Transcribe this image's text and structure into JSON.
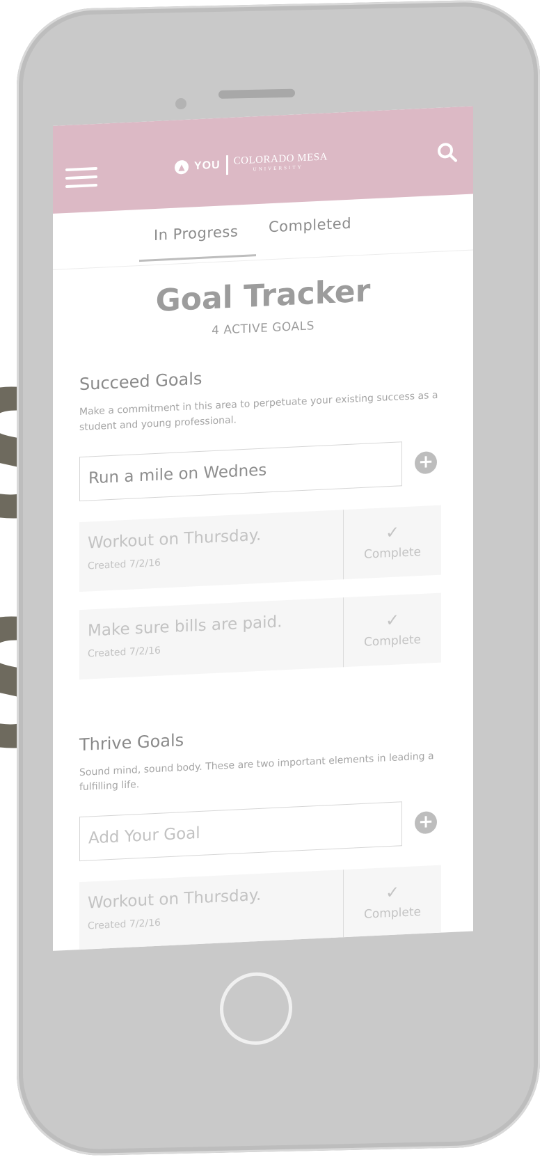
{
  "background": {
    "partial_letters": [
      "S",
      "S"
    ],
    "letter_color": "#6e6a5e"
  },
  "header": {
    "brand_you": "YOU",
    "brand_university": "COLORADO MESA",
    "brand_university_sub": "UNIVERSITY",
    "color": "#dcb9c5",
    "icons": [
      "hamburger-icon",
      "logo-icon",
      "search-icon"
    ]
  },
  "tabs": {
    "in_progress": "In Progress",
    "completed": "Completed",
    "active": "In Progress"
  },
  "main": {
    "title": "Goal Tracker",
    "subtitle": "4 ACTIVE GOALS"
  },
  "succeed": {
    "title": "Succeed Goals",
    "description": "Make a commitment in this area to perpetuate your existing success as a student and young professional.",
    "input_value": "Run a mile on Wednes",
    "goals": [
      {
        "text": "Workout on Thursday.",
        "date": "Created 7/2/16",
        "action": "Complete"
      },
      {
        "text": "Make sure bills are paid.",
        "date": "Created 7/2/16",
        "action": "Complete"
      }
    ]
  },
  "thrive": {
    "title": "Thrive Goals",
    "description": "Sound mind, sound body. These are two important elements in leading a fulfilling life.",
    "input_placeholder": "Add Your Goal",
    "goals": [
      {
        "text": "Workout on Thursday.",
        "date": "Created 7/2/16",
        "action": "Complete"
      }
    ]
  }
}
